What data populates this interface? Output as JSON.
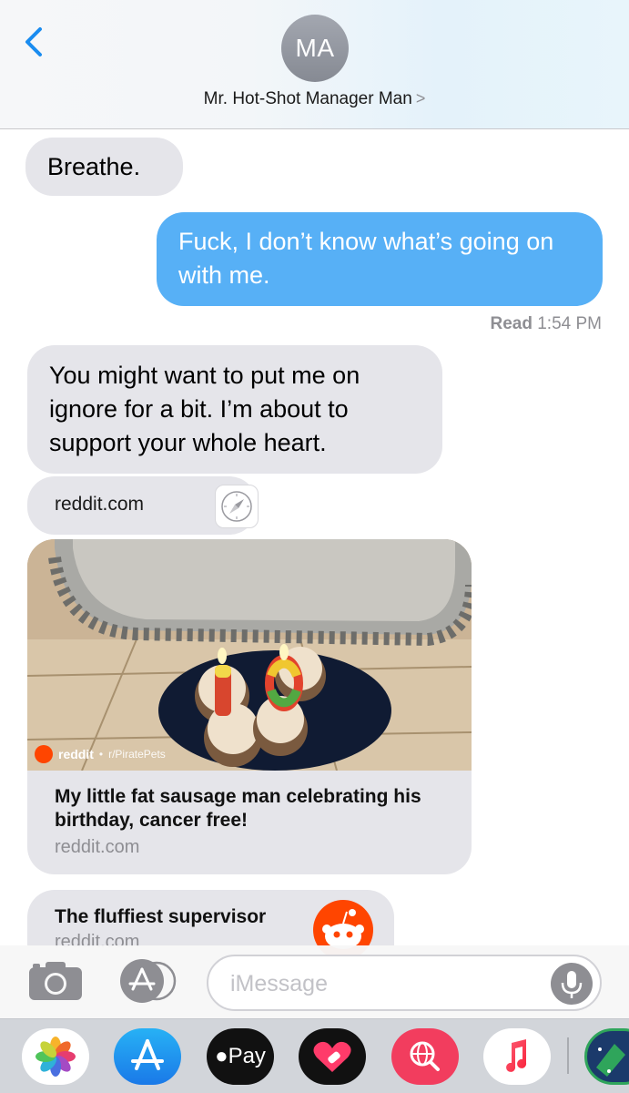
{
  "header": {
    "back_icon": "chevron-left-icon",
    "avatar_initials": "MA",
    "contact_name": "Mr. Hot-Shot Manager Man",
    "contact_chevron": ">"
  },
  "messages": [
    {
      "direction": "incoming",
      "text": "Breathe."
    },
    {
      "direction": "outgoing",
      "text": "Fuck, I don’t know what’s going on with me."
    },
    {
      "direction": "incoming",
      "text": "You might want to put me on ignore for a bit. I’m about to support your whole heart."
    }
  ],
  "receipt": {
    "status": "Read",
    "time": "1:54 PM"
  },
  "link_pill": {
    "domain": "reddit.com",
    "icon": "safari-compass-icon"
  },
  "link_card": {
    "badge_name": "reddit",
    "badge_sub": "r/PiratePets",
    "title": "My little fat sausage man celebrating his birthday, cancer free!",
    "domain": "reddit.com"
  },
  "link_card_2": {
    "title": "The fluffiest supervisor",
    "domain": "reddit.com",
    "icon": "reddit-snoo-icon"
  },
  "input": {
    "placeholder": "iMessage"
  },
  "app_strip": {
    "apps": [
      "photos-icon",
      "app-store-icon",
      "apple-pay-icon",
      "digital-touch-icon",
      "web-search-icon",
      "music-icon",
      "sticker-app-icon"
    ],
    "apple_pay_label": "Pay"
  },
  "colors": {
    "outgoing_bubble": "#57b0f6",
    "incoming_bubble": "#e5e5ea",
    "ios_blue": "#1a8cf0"
  }
}
